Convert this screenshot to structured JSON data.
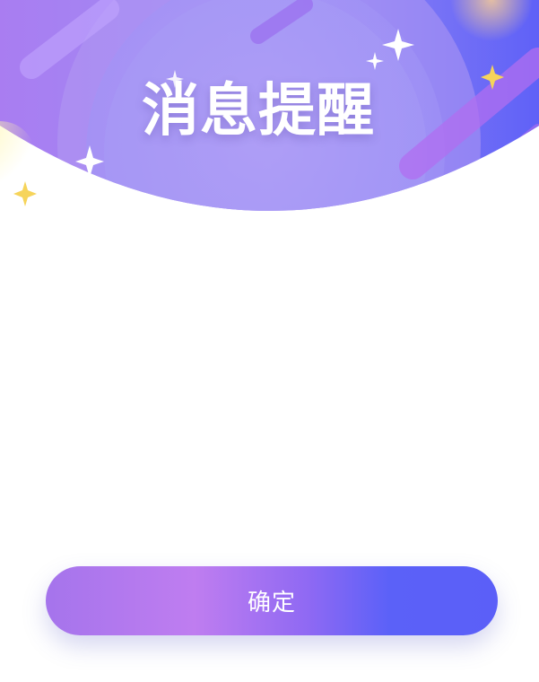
{
  "dialog": {
    "title": "消息提醒",
    "confirm_label": "确定"
  },
  "theme": {
    "header_gradient_start": "#b18cf0",
    "header_gradient_end": "#5f5ff7",
    "button_gradient_start": "#a574ec",
    "button_gradient_end": "#5b5ff8",
    "sparkle_white": "#ffffff",
    "sparkle_gold": "#f6d45a"
  }
}
